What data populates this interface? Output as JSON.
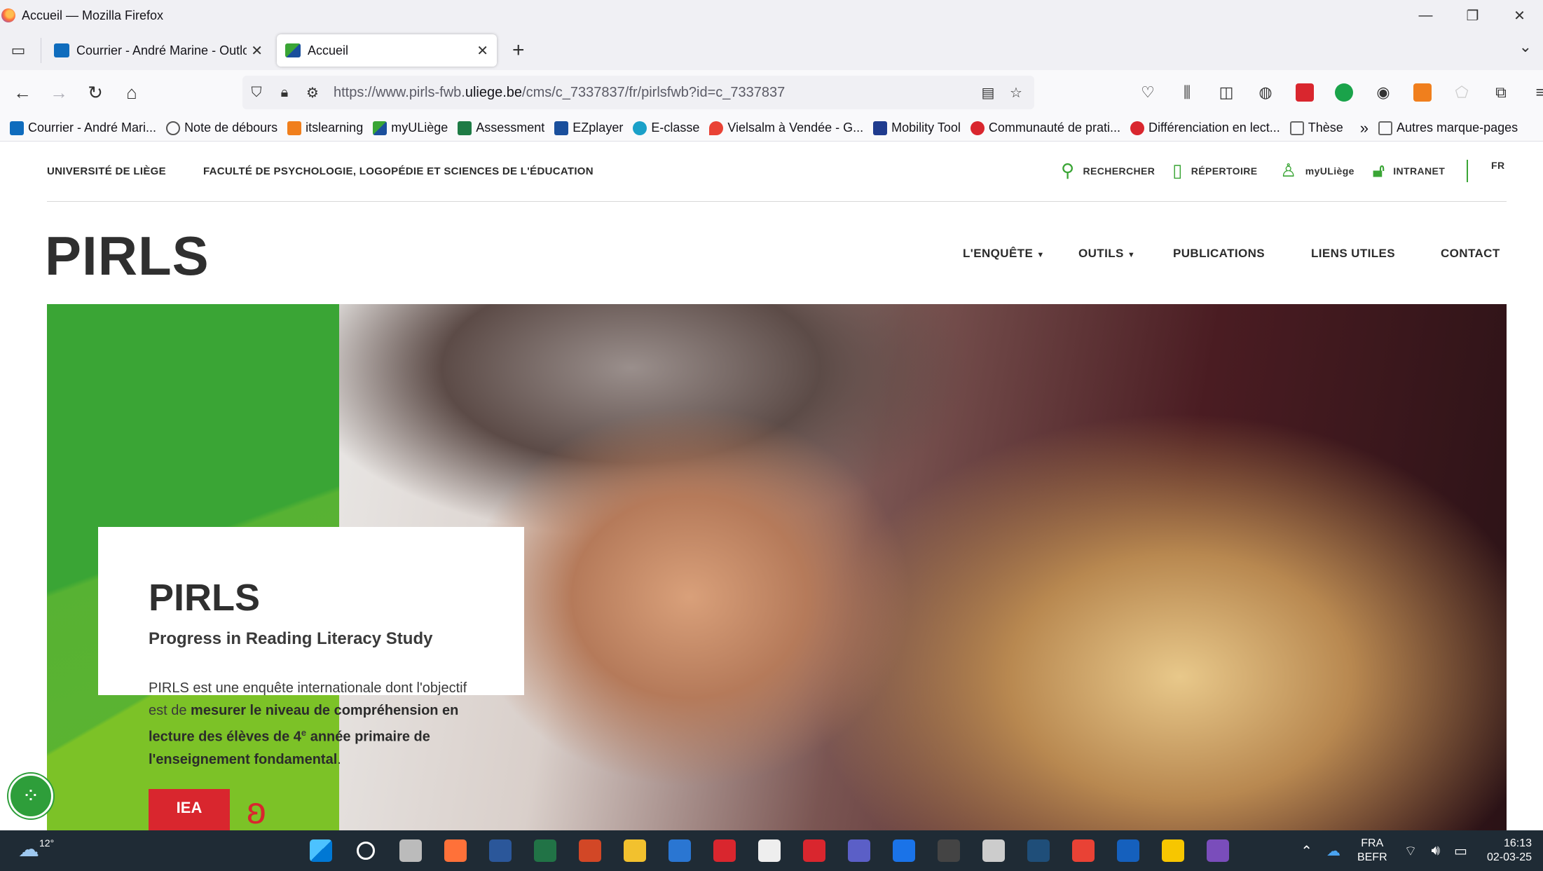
{
  "window": {
    "title": "Accueil — Mozilla Firefox"
  },
  "tabs": [
    {
      "label": "Courrier - André Marine - Outlo",
      "favicon_color": "#0f6cbd"
    },
    {
      "label": "Accueil",
      "favicon_color": "#e8f3e0"
    }
  ],
  "url": {
    "prefix": "https://www.pirls-fwb.",
    "domain": "uliege.be",
    "path": "/cms/c_7337837/fr/pirlsfwb?id=c_7337837"
  },
  "bookmarks": [
    {
      "label": "Courrier - André Mari...",
      "color": "#0f6cbd"
    },
    {
      "label": "Note de débours",
      "color": "#555555"
    },
    {
      "label": "itslearning",
      "color": "#f07f1d"
    },
    {
      "label": "myULiège",
      "color": "#3aa535"
    },
    {
      "label": "Assessment",
      "color": "#1e7b45"
    },
    {
      "label": "EZplayer",
      "color": "#1a4f9c"
    },
    {
      "label": "E-classe",
      "color": "#1aa0c8"
    },
    {
      "label": "Vielsalm à Vendée - G...",
      "color": "#e94235"
    },
    {
      "label": "Mobility Tool",
      "color": "#1f3b8e"
    },
    {
      "label": "Communauté de prati...",
      "color": "#d9262e"
    },
    {
      "label": "Différenciation en lect...",
      "color": "#d9262e"
    },
    {
      "label": "Thèse",
      "color": "#666666"
    }
  ],
  "bookmarks_more": "Autres marque-pages",
  "site": {
    "university": "UNIVERSITÉ DE LIÈGE",
    "faculty": "FACULTÉ DE PSYCHOLOGIE, LOGOPÉDIE ET SCIENCES DE L'ÉDUCATION",
    "utility": {
      "search": "RECHERCHER",
      "directory": "RÉPERTOIRE",
      "myuliege": "myULiège",
      "intranet": "INTRANET",
      "lang": "FR"
    },
    "logo": "PIRLS",
    "nav": {
      "survey": "L'ENQUÊTE",
      "tools": "OUTILS",
      "publications": "PUBLICATIONS",
      "links": "LIENS UTILES",
      "contact": "CONTACT"
    },
    "card": {
      "title": "PIRLS",
      "subtitle": "Progress in Reading Literacy Study",
      "desc_start": "PIRLS est une enquête internationale dont l'objectif est de ",
      "desc_bold": "mesurer le niveau de compréhension en lecture des élèves de 4",
      "desc_sup": "e",
      "desc_bold2": " année primaire de l'enseignement fondamental",
      "desc_end": ".",
      "logo_text": "IEA"
    }
  },
  "taskbar": {
    "temperature": "12°",
    "apps": [
      "#0078d4",
      "#ffffff",
      "#bbbbbb",
      "#ff7139",
      "#2b579a",
      "#217346",
      "#d24726",
      "#f2c12e",
      "#2a76d2",
      "#d9262e",
      "#eeeeee",
      "#d9262e",
      "#5b5fc7",
      "#1a73e8",
      "#444444",
      "#cccccc",
      "#1f4e79",
      "#e94235",
      "#1560bd",
      "#f7c600",
      "#7a4dbb"
    ],
    "lang_top": "FRA",
    "lang_bottom": "BEFR",
    "time": "16:13",
    "date": "02-03-25"
  }
}
